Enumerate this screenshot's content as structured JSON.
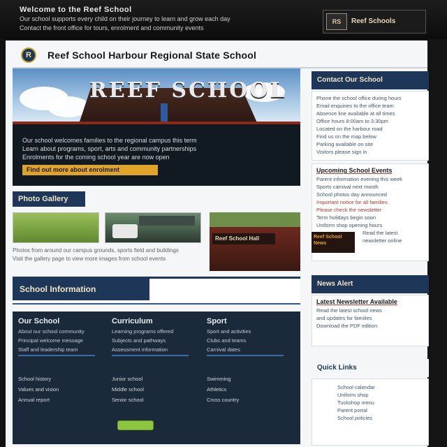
{
  "topbar": {
    "title": "Welcome to the Reef School",
    "line1": "Our school supports every child on their journey to learn and grow each day",
    "line2": "Contact the front office for tours, enrolment and community events",
    "logo_mark": "RS",
    "logo_text": "Reef Schools"
  },
  "header": {
    "badge": "R",
    "title": "Reef School Harbour Regional State School"
  },
  "hero": {
    "sign": "REEF SCHOOL",
    "line1": "Our school welcomes families to the regional campus this term",
    "line2": "Learn about programs, sport, arts and community partnerships",
    "line3": "Enrolments for the coming school year are now open",
    "button": "Find out more about enrolment"
  },
  "gallery": {
    "label": "Photo Gallery",
    "thumb3_sign": "Reef School Hall",
    "caption1": "Photos from around our campus grounds, sports field and buildings",
    "caption2": "Visit the gallery page to view more images from school events"
  },
  "section": {
    "title": "School Information"
  },
  "features": {
    "columns": [
      {
        "heading": "Our School",
        "lines": [
          "About our school community",
          "Principal welcome message",
          "Staff and leadership team"
        ],
        "list": [
          "School history",
          "Values and vision",
          "Annual report"
        ]
      },
      {
        "heading": "Curriculum",
        "lines": [
          "Learning programs offered",
          "Subjects and pathways",
          "Assessment information"
        ],
        "list": [
          "Junior school",
          "Middle school",
          "Senior school"
        ]
      },
      {
        "heading": "Sport",
        "lines": [
          "Sport and activities",
          "Clubs and teams",
          "Carnival dates"
        ],
        "list": [
          "Swimming",
          "Athletics",
          "Cross country"
        ]
      }
    ]
  },
  "sidebar": {
    "box1_head": "Contact Our School",
    "box1_lines": [
      "Phone the school office during hours",
      "Email enquiries to the office team",
      "Absence line available at all times",
      "Office hours 8:00am to 3:30pm",
      "Located on the harbour road",
      "Find us on the map below",
      "Parking available on site",
      "Visitors please sign in"
    ],
    "box2_head": "Upcoming School Events",
    "box2_lines": [
      "Parent information evening this week",
      "Sports carnival next month",
      "School photos day announced",
      "Term holidays begin soon",
      "Uniform shop opening hours"
    ],
    "box2_red": [
      "Important notice for all families",
      "Please check the newsletter"
    ],
    "thumb_text": "Reef School News",
    "thumb_lines": [
      "Read the latest",
      "newsletter online"
    ],
    "box3_head": "News Alert",
    "box3_sub": "Latest Newsletter Available",
    "box3_lines": [
      "Read the latest school news",
      "and updates for families",
      "Download the PDF edition"
    ],
    "box4_head": "Quick Links",
    "box4_lines": [
      "School calendar",
      "Uniform shop",
      "Tuckshop menu",
      "Parent portal",
      "School policies"
    ]
  }
}
